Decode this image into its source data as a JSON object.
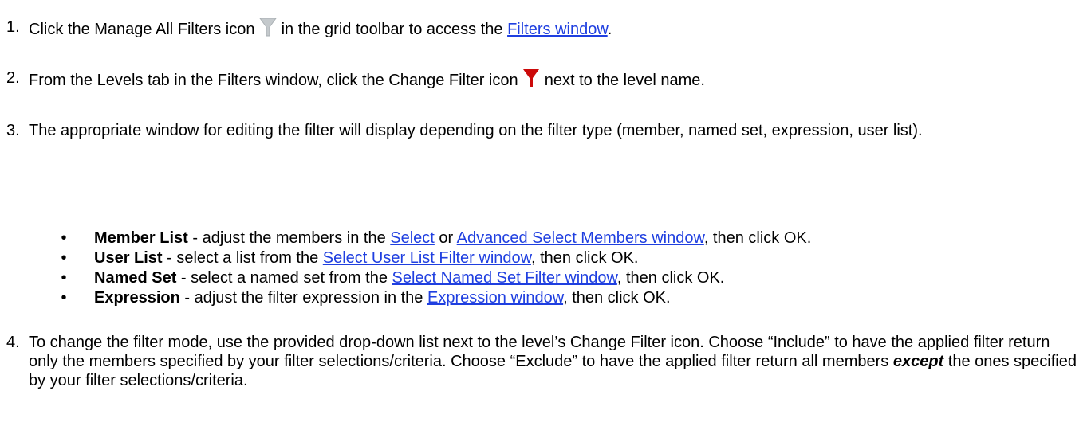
{
  "steps": [
    {
      "num": "1.",
      "before": "Click the Manage All Filters icon ",
      "icon": "filter-gray-icon",
      "middle": " in the grid toolbar to access the ",
      "link": "Filters window",
      "after": "."
    },
    {
      "num": "2.",
      "before": "From the Levels tab in the Filters window, click the Change Filter icon ",
      "icon": "filter-red-icon",
      "after": " next to the level name."
    },
    {
      "num": "3.",
      "text": "The appropriate window for editing the filter will display depending on the filter type (member, named set, expression, user list)."
    },
    {
      "num": "4.",
      "p1": "To change the filter mode, use the provided drop-down list next to the level’s Change Filter icon. Choose “Include” to have the applied filter return only the members specified by your filter selections/criteria. Choose “Exclude” to have the applied filter return all members ",
      "emph": "except",
      "p2": " the ones specified by your filter selections/criteria."
    }
  ],
  "bullets": [
    {
      "bold": "Member List",
      "t1": " - adjust the members in the ",
      "link1": "Select",
      "t2": " or ",
      "link2": "Advanced Select Members window",
      "t3": ", then click OK."
    },
    {
      "bold": "User List",
      "t1": " - select a list from the ",
      "link1": "Select User List Filter window",
      "t2": ", then click OK."
    },
    {
      "bold": "Named Set",
      "t1": " - select a named set from the ",
      "link1": "Select Named Set Filter window",
      "t2": ", then click OK."
    },
    {
      "bold": "Expression",
      "t1": " - adjust the filter expression in the ",
      "link1": "Expression window",
      "t2": ", then click OK."
    }
  ],
  "bullet_char": "•",
  "colors": {
    "link": "#1f3fe0",
    "gray_icon": "#c4c9cc",
    "red_icon": "#cc0a0a"
  }
}
